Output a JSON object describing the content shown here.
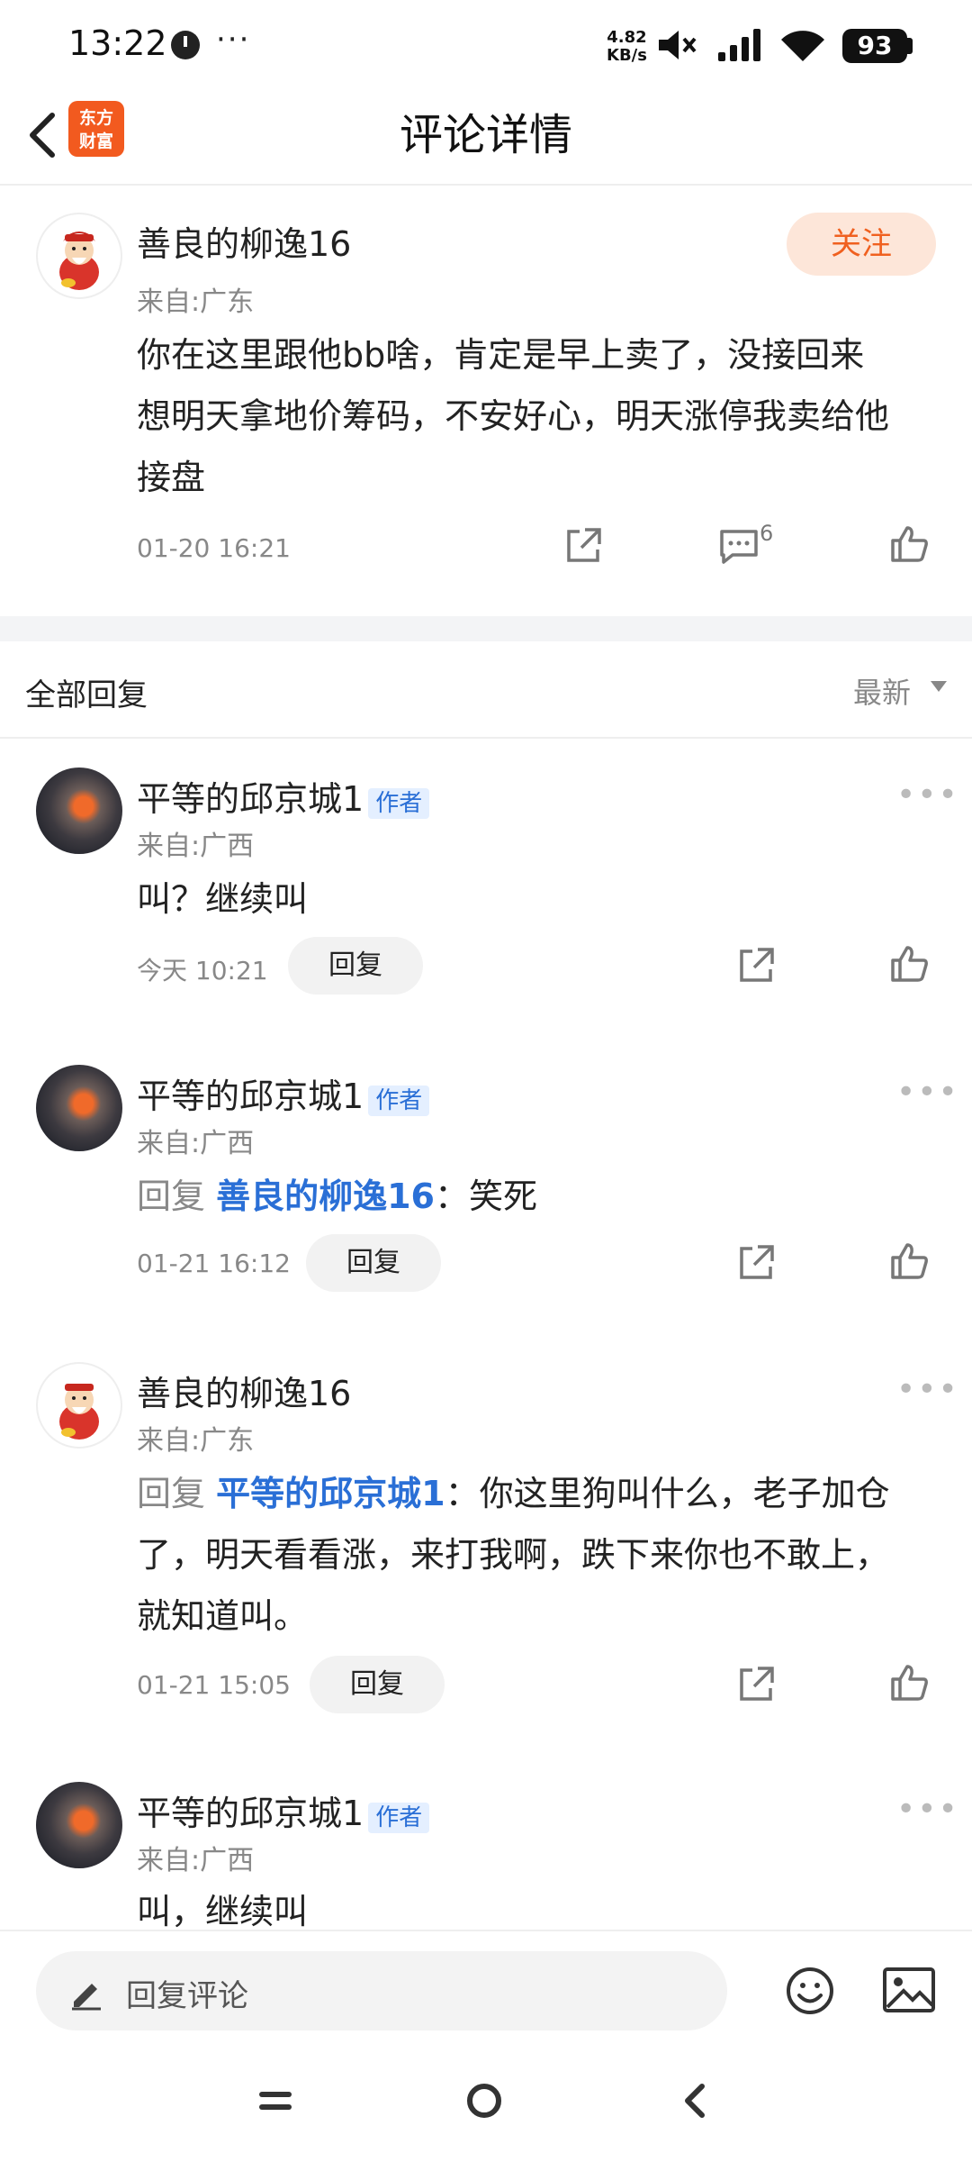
{
  "status_bar": {
    "time": "13:22",
    "dots": "···",
    "net_speed_value": "4.82",
    "net_speed_unit": "KB/s",
    "battery": "93"
  },
  "header": {
    "title": "评论详情",
    "logo_line1": "东方",
    "logo_line2": "财富"
  },
  "main_comment": {
    "username": "善良的柳逸16",
    "region": "来自:广东",
    "follow_label": "关注",
    "text_line1": "你在这里跟他bb啥，肯定是早上卖了，没接回来",
    "text_line2": "想明天拿地价筹码，不安好心，明天涨停我卖给他",
    "text_line3": "接盘",
    "time": "01-20 16:21",
    "comment_count": "6"
  },
  "replies_section": {
    "title": "全部回复",
    "sort": "最新"
  },
  "replies": [
    {
      "username": "平等的邱京城1",
      "tag": "作者",
      "region": "来自:广西",
      "text": "叫？继续叫",
      "time": "今天 10:21",
      "reply_label": "回复"
    },
    {
      "username": "平等的邱京城1",
      "tag": "作者",
      "region": "来自:广西",
      "reply_prefix": "回复",
      "mention": "善良的柳逸16",
      "text": "：笑死",
      "time": "01-21 16:12",
      "reply_label": "回复"
    },
    {
      "username": "善良的柳逸16",
      "region": "来自:广东",
      "reply_prefix": "回复",
      "mention": "平等的邱京城1",
      "text_line1": "：你这里狗叫什么，老子加仓",
      "text_line2": "了，明天看看涨，来打我啊，跌下来你也不敢上，",
      "text_line3": "就知道叫。",
      "time": "01-21 15:05",
      "reply_label": "回复"
    },
    {
      "username": "平等的邱京城1",
      "tag": "作者",
      "region": "来自:广西",
      "text": "叫，继续叫"
    }
  ],
  "bottom_bar": {
    "placeholder": "回复评论"
  }
}
